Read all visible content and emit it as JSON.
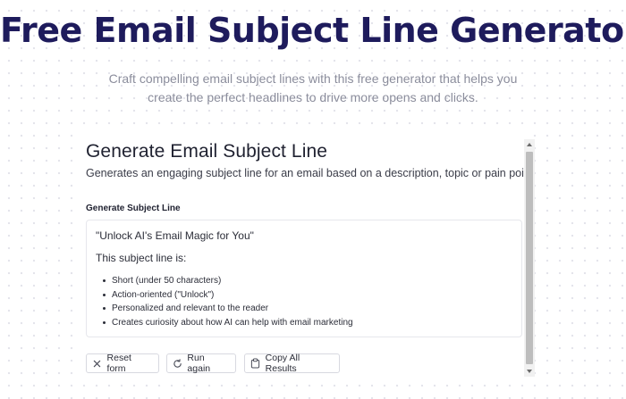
{
  "hero": {
    "title": "Free Email Subject Line Generator",
    "subtitle": "Craft compelling email subject lines with this free generator that helps you create the perfect headlines to drive more opens and clicks."
  },
  "card": {
    "title": "Generate Email Subject Line",
    "description": "Generates an engaging subject line for an email based on a description, topic or pain point",
    "section_label": "Generate Subject Line",
    "output": {
      "subject": "\"Unlock AI's Email Magic for You\"",
      "intro": "This subject line is:",
      "bullets": [
        "Short (under 50 characters)",
        "Action-oriented (\"Unlock\")",
        "Personalized and relevant to the reader",
        "Creates curiosity about how AI can help with email marketing"
      ]
    },
    "actions": {
      "reset_label": "Reset form",
      "reset_icon": "close-icon",
      "run_label": "Run again",
      "run_icon": "refresh-icon",
      "copy_label": "Copy All Results",
      "copy_icon": "clipboard-icon"
    }
  },
  "colors": {
    "title": "#1e1b5c",
    "subtitle": "#8b8d9c",
    "border": "#d8d9e0"
  }
}
